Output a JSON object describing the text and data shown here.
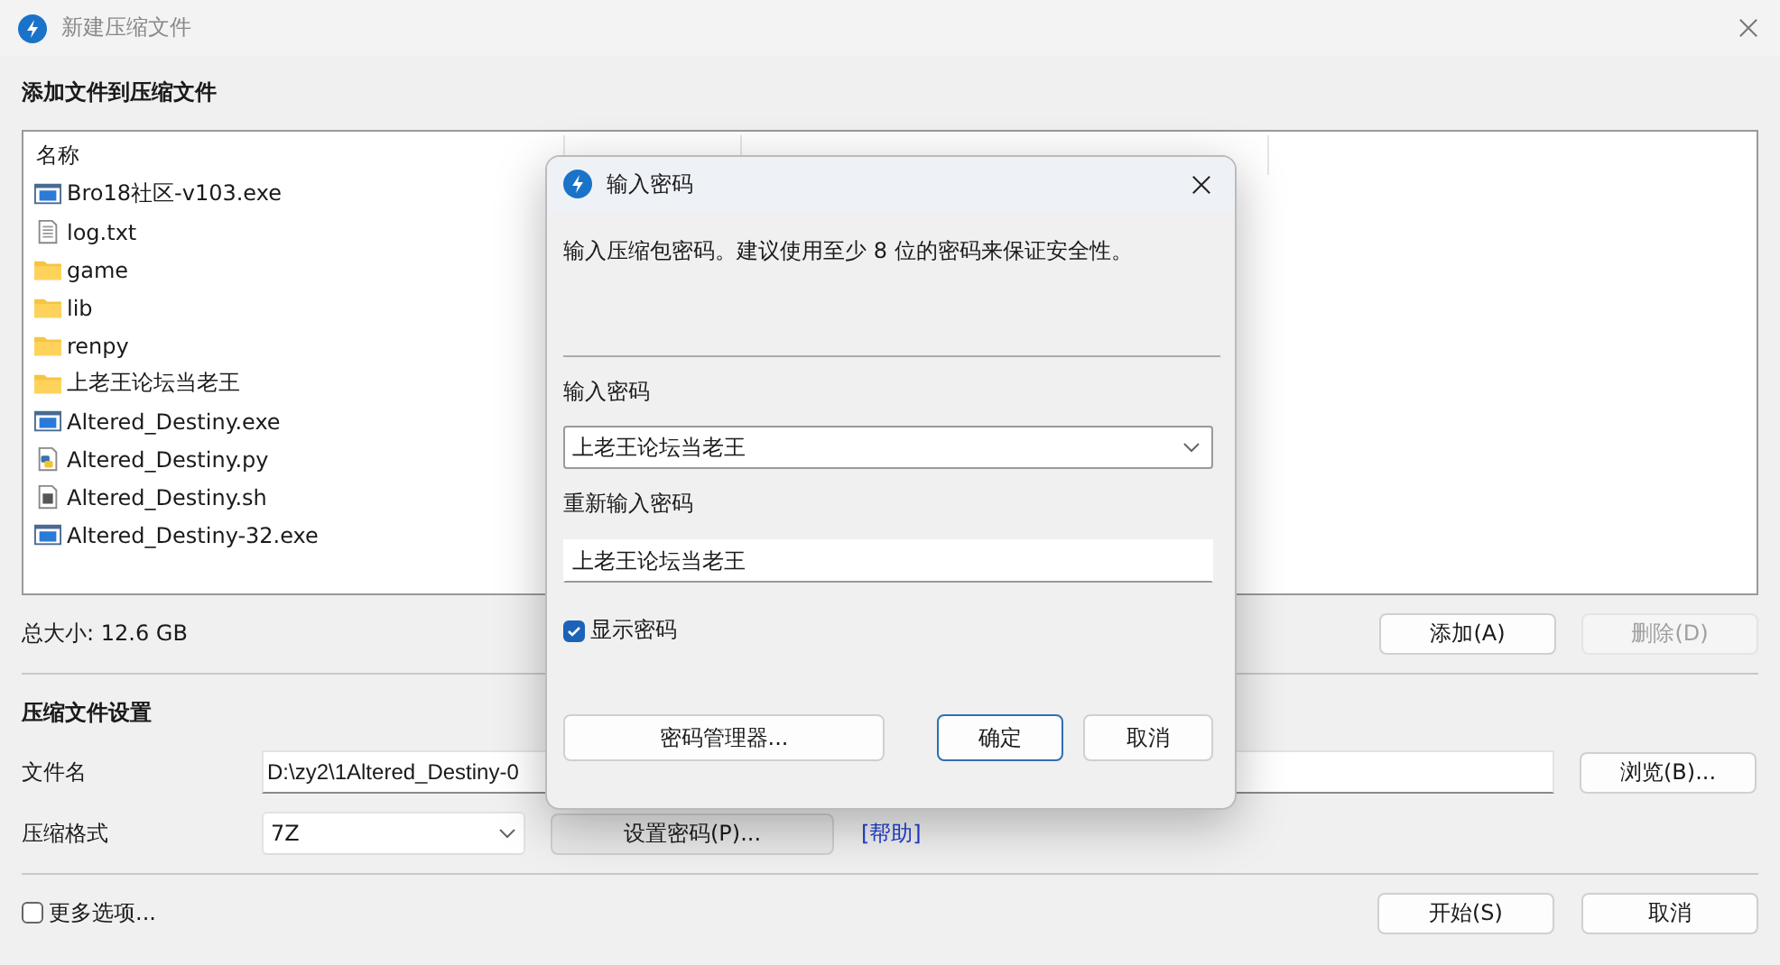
{
  "window": {
    "title": "新建压缩文件"
  },
  "add_section": {
    "heading": "添加文件到压缩文件",
    "columns": [
      "名称"
    ],
    "files": [
      {
        "name": "Bro18社区-v103.exe",
        "kind": "exe"
      },
      {
        "name": "log.txt",
        "kind": "text"
      },
      {
        "name": "game",
        "kind": "folder"
      },
      {
        "name": "lib",
        "kind": "folder"
      },
      {
        "name": "renpy",
        "kind": "folder"
      },
      {
        "name": "上老王论坛当老王",
        "kind": "folder"
      },
      {
        "name": "Altered_Destiny.exe",
        "kind": "exe"
      },
      {
        "name": "Altered_Destiny.py",
        "kind": "python"
      },
      {
        "name": "Altered_Destiny.sh",
        "kind": "script"
      },
      {
        "name": "Altered_Destiny-32.exe",
        "kind": "exe"
      }
    ],
    "total_size": "总大小: 12.6 GB",
    "buttons": [
      {
        "label": "添加(A)",
        "disabled": false
      },
      {
        "label": "删除(D)",
        "disabled": true
      }
    ]
  },
  "settings": {
    "heading": "压缩文件设置",
    "filename_label": "文件名",
    "filename_value": "D:\\zy2\\1Altered_Destiny-0",
    "browse_button": "浏览(B)...",
    "format_label": "压缩格式",
    "format_value": "7Z",
    "password_button": "设置密码(P)...",
    "help_link": "[帮助]"
  },
  "more_options": {
    "label": "更多选项...",
    "checked": false
  },
  "footer_buttons": [
    "开始(S)",
    "取消"
  ],
  "password_dialog": {
    "title": "输入密码",
    "description": "输入压缩包密码。建议使用至少 8 位的密码来保证安全性。",
    "password_label": "输入密码",
    "password_value": "上老王论坛当老王",
    "confirm_label": "重新输入密码",
    "confirm_value": "上老王论坛当老王",
    "show_password": {
      "label": "显示密码",
      "checked": true
    },
    "buttons": [
      {
        "label": "密码管理器...",
        "default": false
      },
      {
        "label": "确定",
        "default": true
      },
      {
        "label": "取消",
        "default": false
      }
    ]
  }
}
